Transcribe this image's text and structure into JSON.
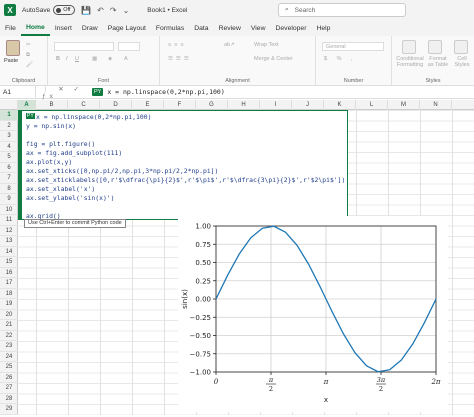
{
  "titlebar": {
    "autosave_label": "AutoSave",
    "autosave_state": "Off",
    "doc_title": "Book1 • Excel",
    "search_placeholder": "Search"
  },
  "menu": [
    "File",
    "Home",
    "Insert",
    "Draw",
    "Page Layout",
    "Formulas",
    "Data",
    "Review",
    "View",
    "Developer",
    "Help"
  ],
  "menu_active": "Home",
  "ribbon": {
    "paste_label": "Paste",
    "groups": [
      "Clipboard",
      "Font",
      "Alignment",
      "Number",
      "Styles"
    ],
    "wrap_text": "Wrap Text",
    "merge_center": "Merge & Center",
    "number_format": "General",
    "conditional_formatting": "Conditional Formatting",
    "format_as_table": "Format as Table",
    "cell_styles": "Cell Styles"
  },
  "formula_bar": {
    "name_box": "A1",
    "py_badge": "PY",
    "formula": "x = np.linspace(0,2*np.pi,100)"
  },
  "columns": [
    "A",
    "B",
    "C",
    "D",
    "E",
    "F",
    "G",
    "H",
    "I",
    "J",
    "K",
    "L",
    "M",
    "N"
  ],
  "rows": [
    "1",
    "2",
    "3",
    "4",
    "5",
    "6",
    "7",
    "8",
    "9",
    "10",
    "11",
    "12",
    "13",
    "14",
    "15",
    "16",
    "17",
    "18",
    "19",
    "20",
    "21",
    "22",
    "23",
    "24",
    "25",
    "26",
    "27",
    "28",
    "29"
  ],
  "code_lines": [
    "x = np.linspace(0,2*np.pi,100)",
    "y = np.sin(x)",
    "",
    "fig = plt.figure()",
    "ax = fig.add_subplot(111)",
    "ax.plot(x,y)",
    "ax.set_xticks([0,np.pi/2,np.pi,3*np.pi/2,2*np.pi])",
    "ax.set_xticklabels([0,r'$\\dfrac{\\pi}{2}$',r'$\\pi$',r'$\\dfrac{3\\pi}{2}$',r'$2\\pi$'])",
    "ax.set_xlabel('x')",
    "ax.set_ylabel('sin(x)')",
    "",
    "ax.grid()"
  ],
  "commit_hint": "Use Ctrl+Enter to commit Python code",
  "chart_data": {
    "type": "line",
    "xlabel": "x",
    "ylabel": "sin(x)",
    "xlim": [
      0,
      6.2832
    ],
    "ylim": [
      -1.0,
      1.0
    ],
    "x_ticks": [
      0,
      1.5708,
      3.1416,
      4.7124,
      6.2832
    ],
    "x_tick_labels": [
      "0",
      "π/2",
      "π",
      "3π/2",
      "2π"
    ],
    "y_ticks": [
      1.0,
      0.75,
      0.5,
      0.25,
      0.0,
      -0.25,
      -0.5,
      -0.75,
      -1.0
    ],
    "y_tick_labels": [
      "1.00",
      "0.75",
      "0.50",
      "0.25",
      "0.00",
      "−0.25",
      "−0.50",
      "−0.75",
      "−1.00"
    ],
    "grid": true,
    "series": [
      {
        "color": "#1f77b4",
        "x": [
          0,
          0.3307,
          0.6614,
          0.9921,
          1.3228,
          1.6535,
          1.9842,
          2.3149,
          2.6456,
          2.9762,
          3.3069,
          3.6376,
          3.9683,
          4.299,
          4.6297,
          4.9604,
          5.2911,
          5.6218,
          5.9525,
          6.2832
        ],
        "y": [
          0,
          0.3247,
          0.6142,
          0.8372,
          0.9694,
          0.9966,
          0.9158,
          0.7357,
          0.4759,
          0.1646,
          -0.1646,
          -0.4759,
          -0.7357,
          -0.9158,
          -0.9966,
          -0.9694,
          -0.8372,
          -0.6142,
          -0.3247,
          0
        ]
      }
    ]
  }
}
